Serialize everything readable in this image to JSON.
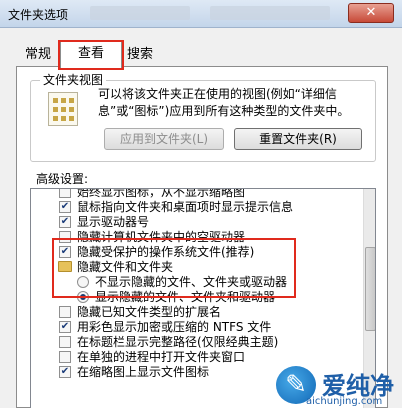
{
  "window": {
    "title": "文件夹选项",
    "close_glyph": "✕"
  },
  "tabs": [
    {
      "label": "常规",
      "selected": false
    },
    {
      "label": "查看",
      "selected": true
    },
    {
      "label": "搜索",
      "selected": false
    }
  ],
  "folder_views": {
    "group_label": "文件夹视图",
    "description": "可以将该文件夹正在使用的视图(例如“详细信息”或“图标”)应用到所有这种类型的文件夹中。",
    "apply_button": "应用到文件夹(L)",
    "reset_button": "重置文件夹(R)"
  },
  "advanced": {
    "label": "高级设置:",
    "items": [
      {
        "type": "checkbox",
        "checked": false,
        "label": "始终显示图标，从不显示缩略图"
      },
      {
        "type": "checkbox",
        "checked": true,
        "label": "鼠标指向文件夹和桌面项时显示提示信息"
      },
      {
        "type": "checkbox",
        "checked": true,
        "label": "显示驱动器号"
      },
      {
        "type": "checkbox",
        "checked": false,
        "label": "隐藏计算机文件夹中的空驱动器"
      },
      {
        "type": "checkbox",
        "checked": true,
        "label": "隐藏受保护的操作系统文件(推荐)"
      },
      {
        "type": "folder",
        "label": "隐藏文件和文件夹"
      },
      {
        "type": "radio",
        "checked": false,
        "label": "不显示隐藏的文件、文件夹或驱动器"
      },
      {
        "type": "radio",
        "checked": true,
        "label": "显示隐藏的文件、文件夹和驱动器"
      },
      {
        "type": "checkbox",
        "checked": false,
        "label": "隐藏已知文件类型的扩展名"
      },
      {
        "type": "checkbox",
        "checked": true,
        "label": "用彩色显示加密或压缩的 NTFS 文件"
      },
      {
        "type": "checkbox",
        "checked": false,
        "label": "在标题栏显示完整路径(仅限经典主题)"
      },
      {
        "type": "checkbox",
        "checked": false,
        "label": "在单独的进程中打开文件夹窗口"
      },
      {
        "type": "checkbox",
        "checked": true,
        "label": "在缩略图上显示文件图标"
      }
    ]
  },
  "watermark": {
    "name": "爱纯净",
    "url": "aichunjing.com"
  },
  "colors": {
    "highlight_border": "#e02a1d",
    "check_mark": "#1c3d7a"
  }
}
